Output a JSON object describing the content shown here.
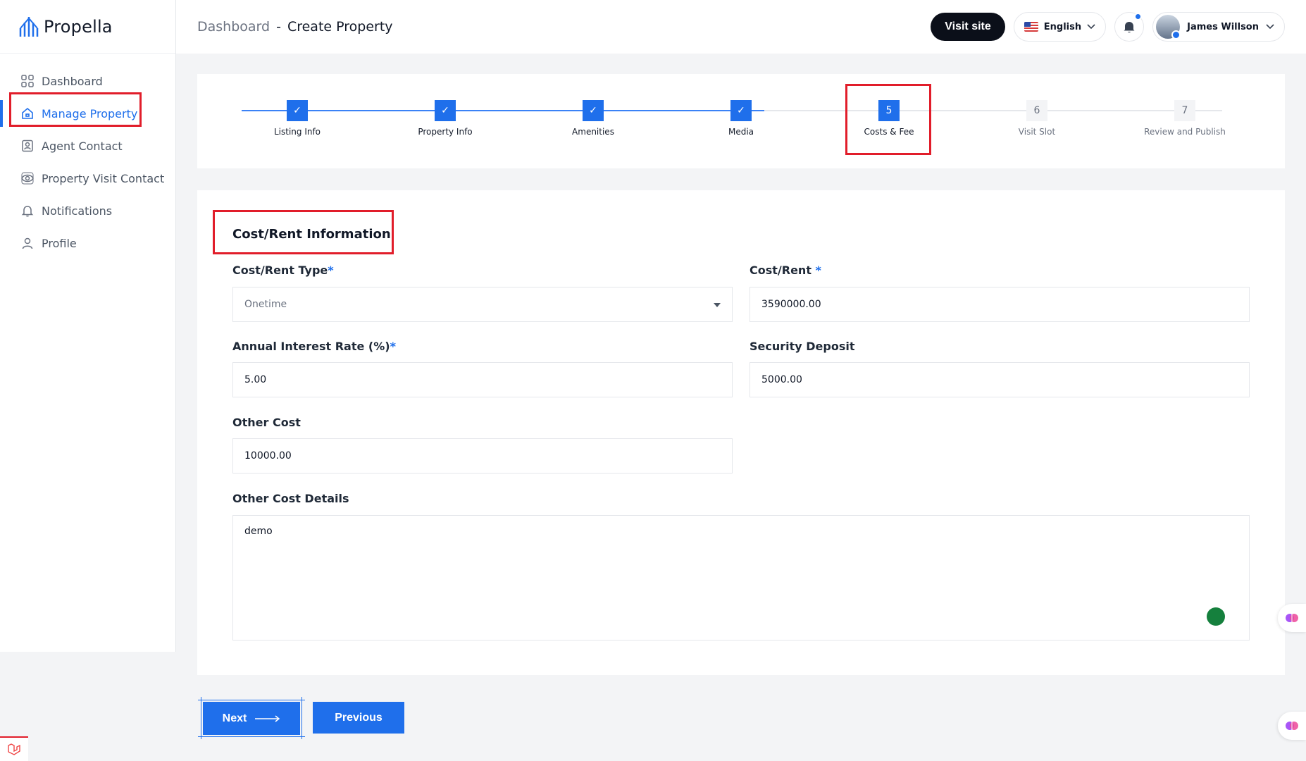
{
  "app": {
    "name": "Propella"
  },
  "sidebar": {
    "items": [
      {
        "label": "Dashboard",
        "icon": "dashboard-grid-icon"
      },
      {
        "label": "Manage Property",
        "icon": "home-icon",
        "active": true
      },
      {
        "label": "Agent Contact",
        "icon": "contact-card-icon"
      },
      {
        "label": "Property Visit Contact",
        "icon": "eye-icon"
      },
      {
        "label": "Notifications",
        "icon": "bell-icon"
      },
      {
        "label": "Profile",
        "icon": "user-icon"
      }
    ]
  },
  "header": {
    "breadcrumb_parent": "Dashboard",
    "breadcrumb_sep": "-",
    "breadcrumb_current": "Create Property",
    "visit_site": "Visit site",
    "language": "English",
    "user_name": "James Willson"
  },
  "stepper": {
    "steps": [
      {
        "number": "1",
        "label": "Listing Info",
        "state": "done"
      },
      {
        "number": "2",
        "label": "Property Info",
        "state": "done"
      },
      {
        "number": "3",
        "label": "Amenities",
        "state": "done"
      },
      {
        "number": "4",
        "label": "Media",
        "state": "done"
      },
      {
        "number": "5",
        "label": "Costs & Fee",
        "state": "current"
      },
      {
        "number": "6",
        "label": "Visit Slot",
        "state": "pending"
      },
      {
        "number": "7",
        "label": "Review and Publish",
        "state": "pending"
      }
    ]
  },
  "form": {
    "section_title": "Cost/Rent Information",
    "cost_rent_type": {
      "label": "Cost/Rent Type",
      "required": "*",
      "value": "Onetime"
    },
    "cost_rent": {
      "label": "Cost/Rent",
      "required": "*",
      "value": "3590000.00"
    },
    "interest_rate": {
      "label": "Annual Interest Rate (%)",
      "required": "*",
      "value": "5.00"
    },
    "security_deposit": {
      "label": "Security Deposit",
      "value": "5000.00"
    },
    "other_cost": {
      "label": "Other Cost",
      "value": "10000.00"
    },
    "other_cost_details": {
      "label": "Other Cost Details",
      "value": "demo"
    }
  },
  "actions": {
    "next": "Next",
    "previous": "Previous"
  },
  "colors": {
    "accent": "#1f6feb",
    "highlight": "#e11d2a"
  }
}
